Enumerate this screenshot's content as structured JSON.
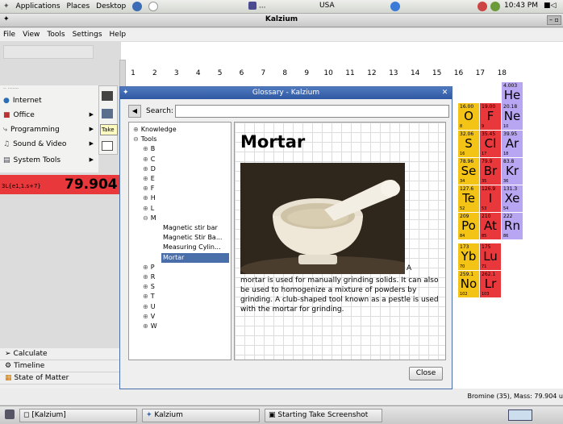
{
  "top_panel": {
    "menus": [
      "Applications",
      "Places",
      "Desktop"
    ],
    "center_btn": "...",
    "location": "USA",
    "time": "10:43 PM"
  },
  "window": {
    "title": "Kalzium",
    "menubar": [
      "File",
      "View",
      "Tools",
      "Settings",
      "Help"
    ]
  },
  "group_numbers": [
    "1",
    "2",
    "3",
    "4",
    "5",
    "6",
    "7",
    "8",
    "9",
    "10",
    "11",
    "12",
    "13",
    "14",
    "15",
    "16",
    "17",
    "18"
  ],
  "elements": [
    {
      "symbol": "He",
      "number": "4.003",
      "sub": "2",
      "color": "#b9a6f2"
    },
    {
      "symbol": "O",
      "number": "16.00",
      "sub": "8",
      "color": "#f3c316"
    },
    {
      "symbol": "F",
      "number": "19.00",
      "sub": "9",
      "color": "#e8383b"
    },
    {
      "symbol": "Ne",
      "number": "20.18",
      "sub": "10",
      "color": "#b9a6f2"
    },
    {
      "symbol": "S",
      "number": "32.06",
      "sub": "16",
      "color": "#f3c316"
    },
    {
      "symbol": "Cl",
      "number": "35.45",
      "sub": "17",
      "color": "#e8383b"
    },
    {
      "symbol": "Ar",
      "number": "39.95",
      "sub": "18",
      "color": "#b9a6f2"
    },
    {
      "symbol": "Se",
      "number": "78.96",
      "sub": "34",
      "color": "#f3c316"
    },
    {
      "symbol": "Br",
      "number": "79.9",
      "sub": "35",
      "color": "#e8383b"
    },
    {
      "symbol": "Kr",
      "number": "83.8",
      "sub": "36",
      "color": "#b9a6f2"
    },
    {
      "symbol": "Te",
      "number": "127.6",
      "sub": "52",
      "color": "#f3c316"
    },
    {
      "symbol": "I",
      "number": "126.9",
      "sub": "53",
      "color": "#e8383b"
    },
    {
      "symbol": "Xe",
      "number": "131.3",
      "sub": "54",
      "color": "#b9a6f2"
    },
    {
      "symbol": "Po",
      "number": "209",
      "sub": "84",
      "color": "#f3c316"
    },
    {
      "symbol": "At",
      "number": "210",
      "sub": "85",
      "color": "#e8383b"
    },
    {
      "symbol": "Rn",
      "number": "222",
      "sub": "86",
      "color": "#b9a6f2"
    },
    {
      "symbol": "Yb",
      "number": "173",
      "sub": "70",
      "color": "#f3c316"
    },
    {
      "symbol": "Lu",
      "number": "175",
      "sub": "71",
      "color": "#e8383b"
    },
    {
      "symbol": "No",
      "number": "259.1",
      "sub": "102",
      "color": "#f3c316"
    },
    {
      "symbol": "Lr",
      "number": "262.1",
      "sub": "103",
      "color": "#e8383b"
    }
  ],
  "apps_menu": {
    "items": [
      "Internet",
      "Office",
      "Programming",
      "Sound & Video",
      "System Tools"
    ],
    "sub_label": "Take"
  },
  "selected_element": {
    "formula": "3L{e1,1.s+7}",
    "mass": "79.904"
  },
  "bottom_tabs": [
    "Calculate",
    "Timeline",
    "State of Matter"
  ],
  "status": "Bromine (35), Mass: 79.904 u",
  "taskbar": [
    "[Kalzium]",
    "Kalzium",
    "Starting Take Screenshot"
  ],
  "glossary": {
    "title": "Glossary - Kalzium",
    "search_label": "Search:",
    "search_value": "",
    "tree": [
      {
        "label": "Knowledge",
        "expander": "⊕"
      },
      {
        "label": "Tools",
        "expander": "⊖"
      },
      {
        "label": "B",
        "expander": "⊕"
      },
      {
        "label": "C",
        "expander": "⊕"
      },
      {
        "label": "D",
        "expander": "⊕"
      },
      {
        "label": "E",
        "expander": "⊕"
      },
      {
        "label": "F",
        "expander": "⊕"
      },
      {
        "label": "H",
        "expander": "⊕"
      },
      {
        "label": "L",
        "expander": "⊕"
      },
      {
        "label": "M",
        "expander": "⊖"
      },
      {
        "label": "Magnetic stir bar",
        "expander": ""
      },
      {
        "label": "Magnetic Stir Ba...",
        "expander": ""
      },
      {
        "label": "Measuring Cylin...",
        "expander": ""
      },
      {
        "label": "Mortar",
        "expander": ""
      },
      {
        "label": "P",
        "expander": "⊕"
      },
      {
        "label": "R",
        "expander": "⊕"
      },
      {
        "label": "S",
        "expander": "⊕"
      },
      {
        "label": "T",
        "expander": "⊕"
      },
      {
        "label": "U",
        "expander": "⊕"
      },
      {
        "label": "V",
        "expander": "⊕"
      },
      {
        "label": "W",
        "expander": "⊕"
      }
    ],
    "heading": "Mortar",
    "body_first": "A",
    "body": "mortar is used for manually grinding solids. It can also be used to homogenize a mixture of powders by grinding. A club-shaped tool known as a pestle is used with the mortar for grinding.",
    "close_label": "Close"
  }
}
